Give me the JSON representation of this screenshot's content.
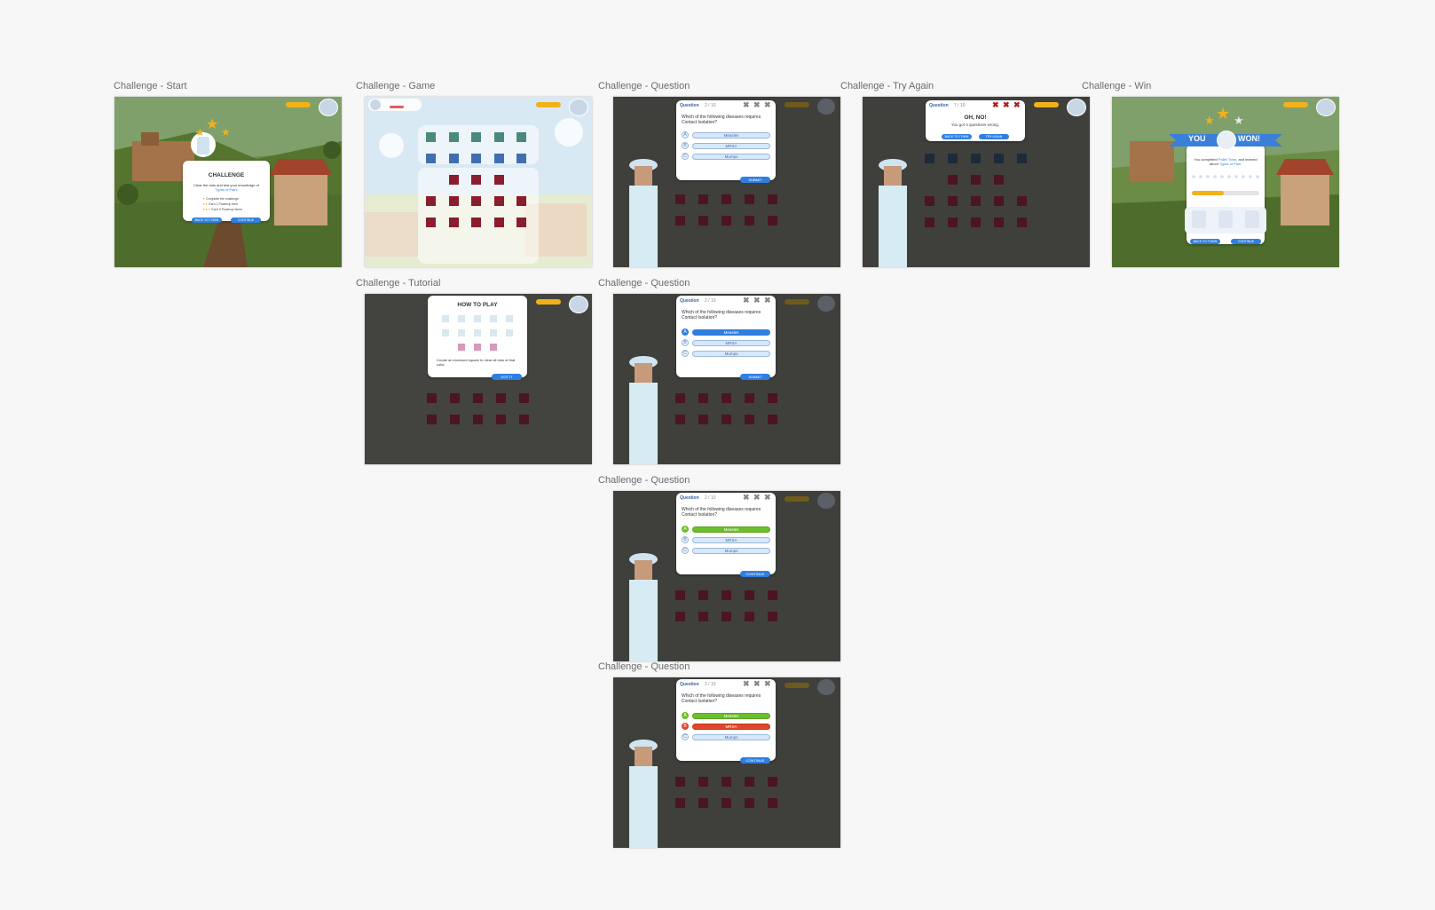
{
  "artboards": {
    "start": "Challenge - Start",
    "game": "Challenge - Game",
    "question1": "Challenge - Question",
    "tryagain": "Challenge - Try Again",
    "win": "Challenge - Win",
    "tutorial": "Challenge - Tutorial",
    "question2": "Challenge - Question",
    "question3": "Challenge - Question",
    "question4": "Challenge - Question"
  },
  "start_card": {
    "title": "CHALLENGE",
    "desc": "Clear the dots and test your knowledge of ",
    "desc_highlight": "Types of Pain!",
    "rule1": "Complete the challenge",
    "rule2": "Earn 1 Powerup Item",
    "rule3": "Earn 3 Powerup Items",
    "btn_back": "BACK TO TOWN",
    "btn_continue": "CONTINUE"
  },
  "question": {
    "label": "Question",
    "count": "2 / 10",
    "text": "Which of the following diseases requires Contact Isolation?",
    "options": [
      {
        "letter": "A",
        "text": "Measles"
      },
      {
        "letter": "B",
        "text": "MRSA"
      },
      {
        "letter": "C",
        "text": "Mumps"
      }
    ],
    "btn_submit": "SUBMIT",
    "btn_continue": "CONTINUE"
  },
  "tryagain_card": {
    "label": "Question",
    "count": "7 / 10",
    "title": "OH, NO!",
    "text": "You got 3 questions wrong.",
    "btn_back": "BACK TO TOWN",
    "btn_try": "TRY AGAIN"
  },
  "win_card": {
    "word1": "YOU",
    "word2": "WON!",
    "text_a": "You completed ",
    "town": "Pallet Town",
    "text_b": ", and learned about ",
    "topic": "Types of Pain",
    "text_c": ".",
    "btn_left": "BACK TO TOWN",
    "btn_right": "CONTINUE"
  },
  "tutorial_card": {
    "title": "HOW TO PLAY",
    "text": "Create an enclosed square to clear all dots of that color.",
    "btn_ok": "GOT IT"
  },
  "colors": {
    "accent_blue": "#2f7fe0",
    "correct_green": "#6cbf2a",
    "wrong_red": "#e0462a",
    "gem_red": "#8a1d2e",
    "gem_blue": "#3f6fb0",
    "gem_teal": "#4a8a7a",
    "hud_yellow": "#f2b11a"
  }
}
